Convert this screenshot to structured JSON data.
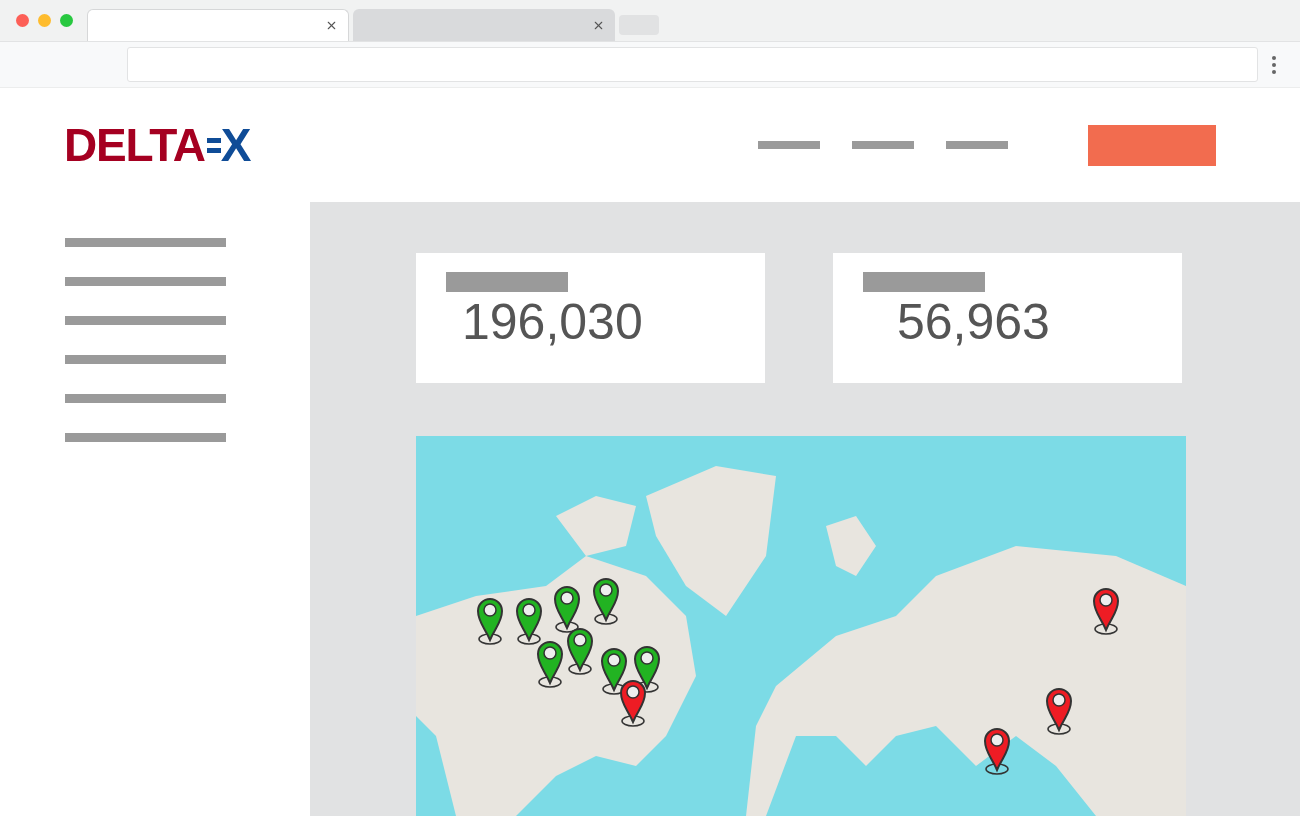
{
  "browser": {
    "tabs": [
      {
        "selected": true
      },
      {
        "selected": false
      }
    ]
  },
  "logo": {
    "main": "DELTA",
    "accent": "X"
  },
  "stats": [
    {
      "value": "196,030"
    },
    {
      "value": "56,963"
    }
  ],
  "map": {
    "pins": [
      {
        "color": "#22b322"
      },
      {
        "color": "#22b322"
      },
      {
        "color": "#22b322"
      },
      {
        "color": "#22b322"
      },
      {
        "color": "#22b322"
      },
      {
        "color": "#22b322"
      },
      {
        "color": "#22b322"
      },
      {
        "color": "#22b322"
      },
      {
        "color": "#ee1c24"
      },
      {
        "color": "#ee1c24"
      },
      {
        "color": "#ee1c24"
      },
      {
        "color": "#ee1c24"
      }
    ]
  }
}
